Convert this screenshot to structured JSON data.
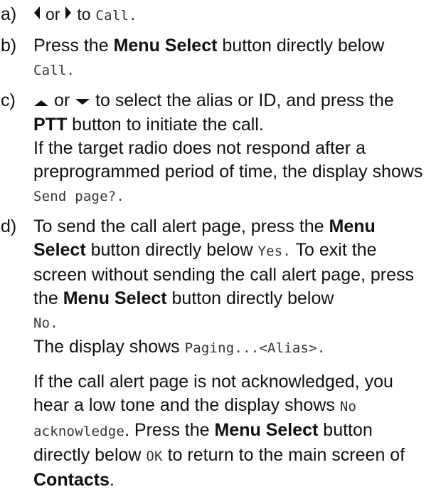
{
  "steps": [
    {
      "marker": "a)",
      "or_word": "or",
      "to_word": "to",
      "display_call": "Call."
    },
    {
      "marker": "b)",
      "t1": "Press the ",
      "menu_select": "Menu Select",
      "t2": " button directly below",
      "display_call": "Call."
    },
    {
      "marker": "c)",
      "or_word": "or",
      "t1": "to select the alias or ID, and press the",
      "ptt": "PTT",
      "t2": " button to initiate the call.",
      "t3": "If the target radio does not respond after a preprogrammed period of time, the display shows ",
      "display_send_page": "Send page?."
    },
    {
      "marker": "d)",
      "t1": "To send the call alert page, press the ",
      "menu": "Menu",
      "select": "Select",
      "t2": " button directly below ",
      "display_yes": "Yes.",
      "t3": " To exit the screen without sending the call alert page, press the ",
      "menu_select": "Menu Select",
      "t4": " button directly below",
      "display_no": "No.",
      "t5": "The display shows ",
      "display_paging": "Paging...<Alias>.",
      "t6": "If the call alert page is not acknowledged, you hear a low tone and the display shows ",
      "display_no_ack": "No acknowledge",
      "t7": ". Press the ",
      "menu_select_2": "Menu Select",
      "t8": " button directly below ",
      "display_ok": "OK",
      "t9": " to return to the main screen of",
      "contacts": "Contacts",
      "t10": "."
    }
  ],
  "icons": {
    "left": "left-arrow-icon",
    "right": "right-arrow-icon",
    "up": "up-arrow-icon",
    "down": "down-arrow-icon"
  }
}
